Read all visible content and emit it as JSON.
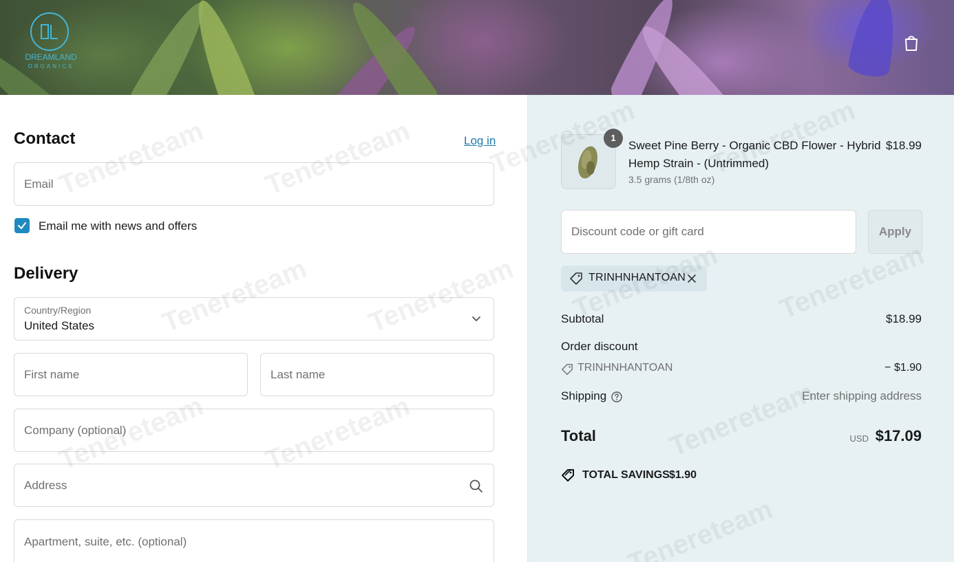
{
  "brand": {
    "name": "DREAMLAND",
    "tagline": "ORGANICS",
    "accent": "#43b6d8"
  },
  "header": {
    "cart_icon": "shopping-bag-icon"
  },
  "contact": {
    "title": "Contact",
    "login_label": "Log in",
    "email_placeholder": "Email",
    "newsletter_label": "Email me with news and offers",
    "newsletter_checked": true
  },
  "delivery": {
    "title": "Delivery",
    "country_label": "Country/Region",
    "country_value": "United States",
    "first_name_placeholder": "First name",
    "last_name_placeholder": "Last name",
    "company_placeholder": "Company (optional)",
    "address_placeholder": "Address",
    "apartment_placeholder": "Apartment, suite, etc. (optional)"
  },
  "order": {
    "item": {
      "quantity": "1",
      "title": "Sweet Pine Berry - Organic CBD Flower - Hybrid Hemp Strain - (Untrimmed)",
      "variant": "3.5 grams (1/8th oz)",
      "price": "$18.99"
    },
    "discount_placeholder": "Discount code or gift card",
    "apply_label": "Apply",
    "applied_code": "TRINHNHANTOAN",
    "subtotal_label": "Subtotal",
    "subtotal_value": "$18.99",
    "order_discount_label": "Order discount",
    "discount_code": "TRINHNHANTOAN",
    "discount_value": "− $1.90",
    "shipping_label": "Shipping",
    "shipping_value": "Enter shipping address",
    "total_label": "Total",
    "currency": "USD",
    "total_value": "$17.09",
    "savings_label": "TOTAL SAVINGS",
    "savings_value": "$1.90"
  },
  "colors": {
    "link": "#1f7aa8",
    "checkbox": "#1f8ac0",
    "summary_bg": "#e7f1f4"
  },
  "watermark_text": "Tenereteam"
}
